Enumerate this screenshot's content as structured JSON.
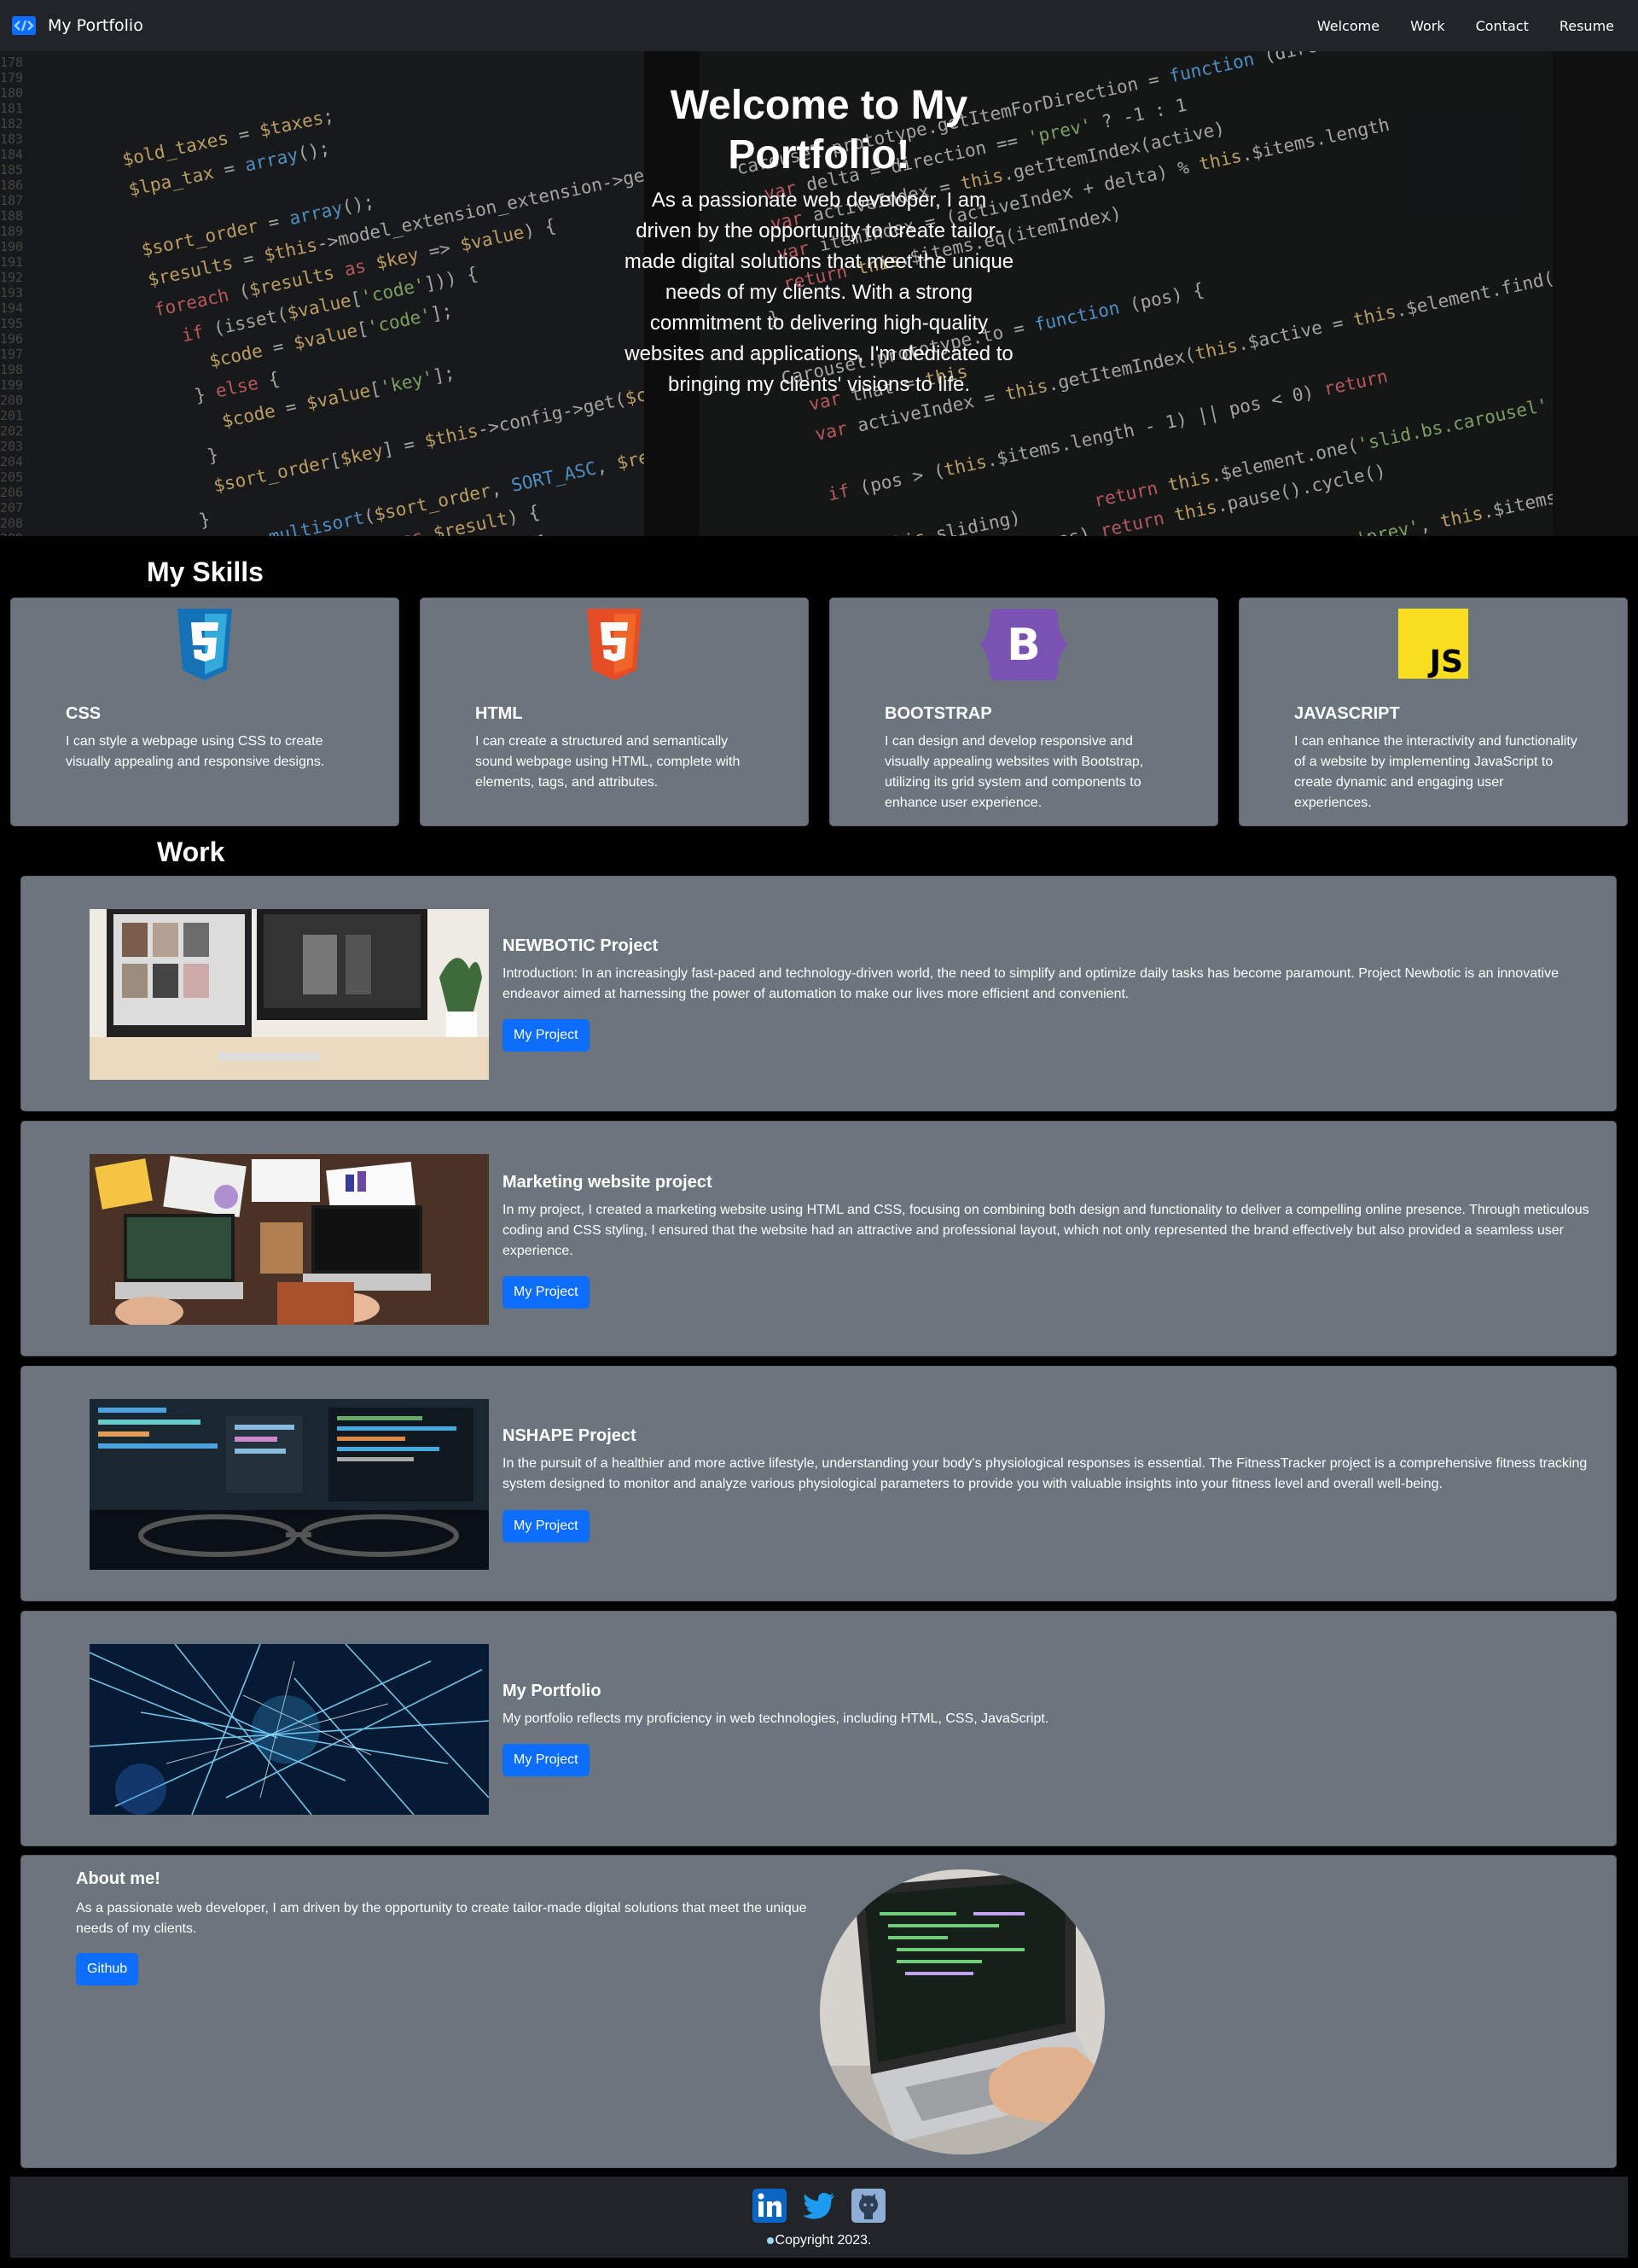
{
  "nav": {
    "brand": "My Portfolio",
    "links": [
      "Welcome",
      "Work",
      "Contact",
      "Resume"
    ]
  },
  "hero": {
    "title": "Welcome to My Portfolio!",
    "subtitle": "As a passionate web developer, I am driven by the opportunity to create tailor-made digital solutions that meet the unique needs of my clients. With a strong commitment to delivering high-quality websites and applications, I'm dedicated to bringing my clients' visions to life."
  },
  "skills": {
    "heading": "My Skills",
    "items": [
      {
        "name": "CSS",
        "icon": "css3-icon",
        "text": "I can style a webpage using CSS to create visually appealing and responsive designs."
      },
      {
        "name": "HTML",
        "icon": "html5-icon",
        "text": "I can create a structured and semantically sound webpage using HTML, complete with elements, tags, and attributes."
      },
      {
        "name": "BOOTSTRAP",
        "icon": "bootstrap-icon",
        "text": "I can design and develop responsive and visually appealing websites with Bootstrap, utilizing its grid system and components to enhance user experience."
      },
      {
        "name": "JAVASCRIPT",
        "icon": "javascript-icon",
        "text": "I can enhance the interactivity and functionality of a website by implementing JavaScript to create dynamic and engaging user experiences."
      }
    ]
  },
  "work": {
    "heading": "Work",
    "button_label": "My Project",
    "projects": [
      {
        "title": "NEWBOTIC Project",
        "text": "Introduction: In an increasingly fast-paced and technology-driven world, the need to simplify and optimize daily tasks has become paramount. Project Newbotic is an innovative endeavor aimed at harnessing the power of automation to make our lives more efficient and convenient."
      },
      {
        "title": "Marketing website project",
        "text": "In my project, I created a marketing website using HTML and CSS, focusing on combining both design and functionality to deliver a compelling online presence. Through meticulous coding and CSS styling, I ensured that the website had an attractive and professional layout, which not only represented the brand effectively but also provided a seamless user experience."
      },
      {
        "title": "NSHAPE Project",
        "text": "In the pursuit of a healthier and more active lifestyle, understanding your body's physiological responses is essential. The FitnessTracker project is a comprehensive fitness tracking system designed to monitor and analyze various physiological parameters to provide you with valuable insights into your fitness level and overall well-being."
      },
      {
        "title": "My Portfolio",
        "text": "My portfolio reflects my proficiency in web technologies, including HTML, CSS, JavaScript."
      }
    ]
  },
  "about": {
    "title": "About me!",
    "text": "As a passionate web developer, I am driven by the opportunity to create tailor-made digital solutions that meet the unique needs of my clients.",
    "button": "Github"
  },
  "footer": {
    "socials": [
      "linkedin-icon",
      "twitter-icon",
      "github-icon"
    ],
    "copyright": "Copyright 2023."
  },
  "colors": {
    "card": "#6c757d",
    "navbar": "#212529",
    "primary": "#0d6efd",
    "page": "#000000"
  }
}
